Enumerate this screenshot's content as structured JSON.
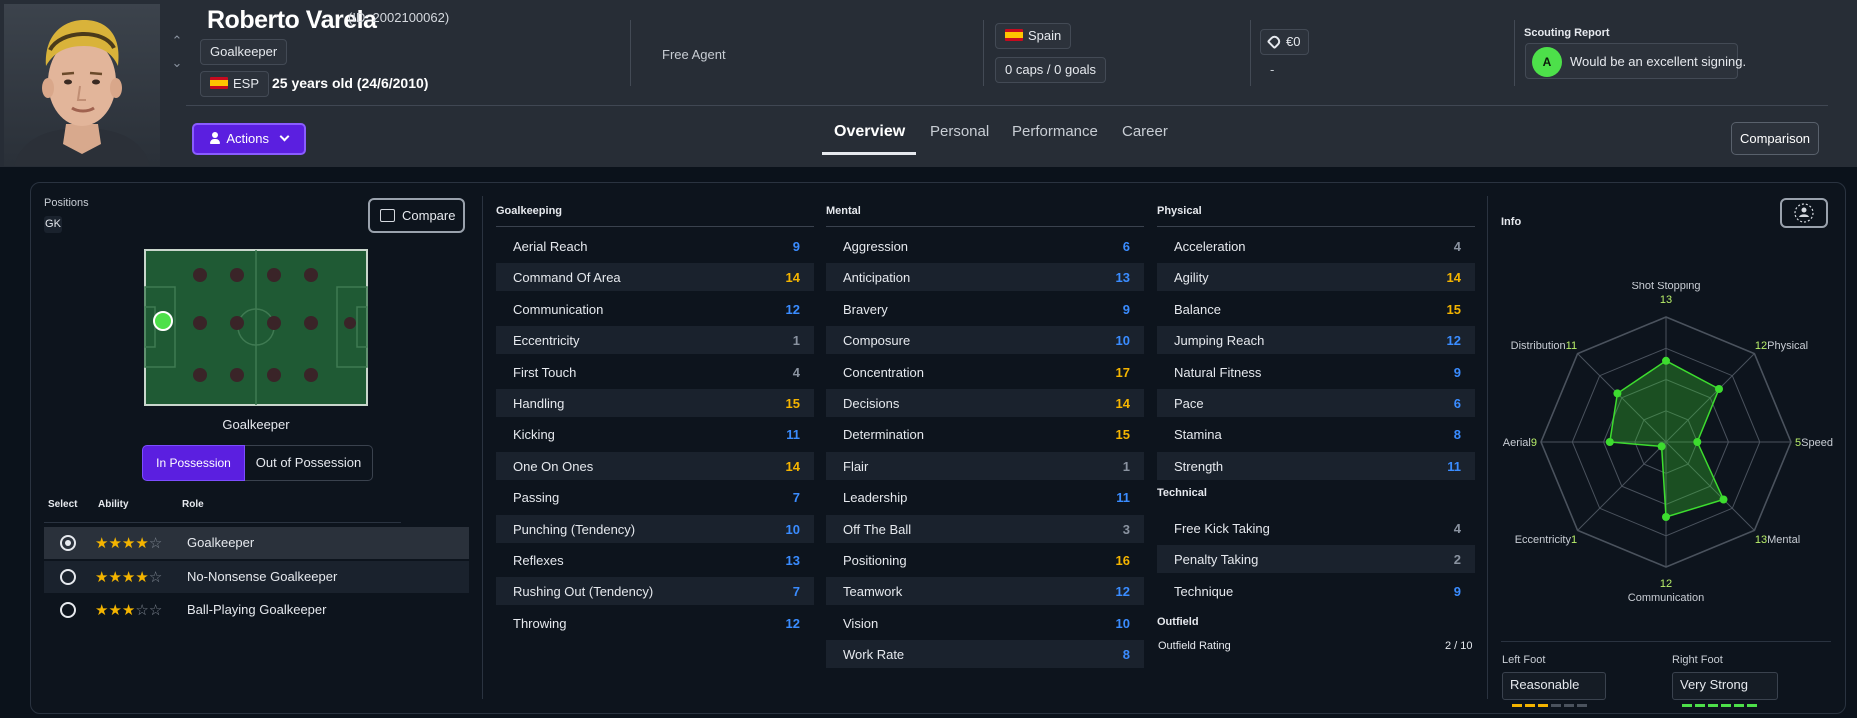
{
  "header": {
    "player_name": "Roberto Varela",
    "player_id": "(ID: 2002100062)",
    "position": "Goalkeeper",
    "nationality_code": "ESP",
    "age_text": "25 years old (24/6/2010)",
    "club_status": "Free Agent",
    "country": "Spain",
    "caps": "0 caps / 0 goals",
    "value": "€0",
    "value_sub": "-",
    "scouting_title": "Scouting Report",
    "scouting_grade": "A",
    "scouting_text": "Would be an excellent signing.",
    "actions_label": "Actions",
    "comparison_label": "Comparison"
  },
  "tabs": [
    {
      "label": "Overview",
      "active": true
    },
    {
      "label": "Personal",
      "active": false
    },
    {
      "label": "Performance",
      "active": false
    },
    {
      "label": "Career",
      "active": false
    }
  ],
  "positions": {
    "label": "Positions",
    "badge": "GK",
    "compare_label": "Compare",
    "pitch_caption": "Goalkeeper",
    "toggle_in": "In Possession",
    "toggle_out": "Out of Possession"
  },
  "roles": {
    "headers": {
      "select": "Select",
      "ability": "Ability",
      "role": "Role"
    },
    "rows": [
      {
        "name": "Goalkeeper",
        "stars": 4,
        "selected": true
      },
      {
        "name": "No-Nonsense Goalkeeper",
        "stars": 4,
        "selected": false
      },
      {
        "name": "Ball-Playing Goalkeeper",
        "stars": 3,
        "selected": false
      }
    ]
  },
  "goalkeeping": {
    "title": "Goalkeeping",
    "rows": [
      {
        "name": "Aerial Reach",
        "value": "9"
      },
      {
        "name": "Command Of Area",
        "value": "14"
      },
      {
        "name": "Communication",
        "value": "12"
      },
      {
        "name": "Eccentricity",
        "value": "1"
      },
      {
        "name": "First Touch",
        "value": "4"
      },
      {
        "name": "Handling",
        "value": "15"
      },
      {
        "name": "Kicking",
        "value": "11"
      },
      {
        "name": "One On Ones",
        "value": "14"
      },
      {
        "name": "Passing",
        "value": "7"
      },
      {
        "name": "Punching (Tendency)",
        "value": "10"
      },
      {
        "name": "Reflexes",
        "value": "13"
      },
      {
        "name": "Rushing Out (Tendency)",
        "value": "7"
      },
      {
        "name": "Throwing",
        "value": "12"
      }
    ]
  },
  "mental": {
    "title": "Mental",
    "rows": [
      {
        "name": "Aggression",
        "value": "6"
      },
      {
        "name": "Anticipation",
        "value": "13"
      },
      {
        "name": "Bravery",
        "value": "9"
      },
      {
        "name": "Composure",
        "value": "10"
      },
      {
        "name": "Concentration",
        "value": "17"
      },
      {
        "name": "Decisions",
        "value": "14"
      },
      {
        "name": "Determination",
        "value": "15"
      },
      {
        "name": "Flair",
        "value": "1"
      },
      {
        "name": "Leadership",
        "value": "11"
      },
      {
        "name": "Off The Ball",
        "value": "3"
      },
      {
        "name": "Positioning",
        "value": "16"
      },
      {
        "name": "Teamwork",
        "value": "12"
      },
      {
        "name": "Vision",
        "value": "10"
      },
      {
        "name": "Work Rate",
        "value": "8"
      }
    ]
  },
  "physical": {
    "title": "Physical",
    "rows": [
      {
        "name": "Acceleration",
        "value": "4"
      },
      {
        "name": "Agility",
        "value": "14"
      },
      {
        "name": "Balance",
        "value": "15"
      },
      {
        "name": "Jumping Reach",
        "value": "12"
      },
      {
        "name": "Natural Fitness",
        "value": "9"
      },
      {
        "name": "Pace",
        "value": "6"
      },
      {
        "name": "Stamina",
        "value": "8"
      },
      {
        "name": "Strength",
        "value": "11"
      }
    ]
  },
  "technical": {
    "title": "Technical",
    "rows": [
      {
        "name": "Free Kick Taking",
        "value": "4"
      },
      {
        "name": "Penalty Taking",
        "value": "2"
      },
      {
        "name": "Technique",
        "value": "9"
      }
    ]
  },
  "outfield": {
    "title": "Outfield",
    "rating_label": "Outfield Rating",
    "rating_value": "2 / 10"
  },
  "info": {
    "title": "Info",
    "radar": [
      {
        "label": "Shot Stopping",
        "value": 13
      },
      {
        "label": "Physical",
        "value": 12
      },
      {
        "label": "Speed",
        "value": 5
      },
      {
        "label": "Mental",
        "value": 13
      },
      {
        "label": "Communication",
        "value": 12
      },
      {
        "label": "Eccentricity",
        "value": 1
      },
      {
        "label": "Aerial",
        "value": 9
      },
      {
        "label": "Distribution",
        "value": 11
      }
    ],
    "radar_max": 20,
    "left_foot_label": "Left Foot",
    "left_foot_value": "Reasonable",
    "left_foot_level": 3,
    "right_foot_label": "Right Foot",
    "right_foot_value": "Very Strong",
    "right_foot_level": 6,
    "foot_level_max": 6
  },
  "colors": {
    "accent": "#5b1fe0",
    "value_high": "#f4b400",
    "value_mid": "#3a8cff",
    "value_low": "#8a93a0",
    "radar_green": "#3ddc2f",
    "pitch_green": "#1f5a34"
  }
}
